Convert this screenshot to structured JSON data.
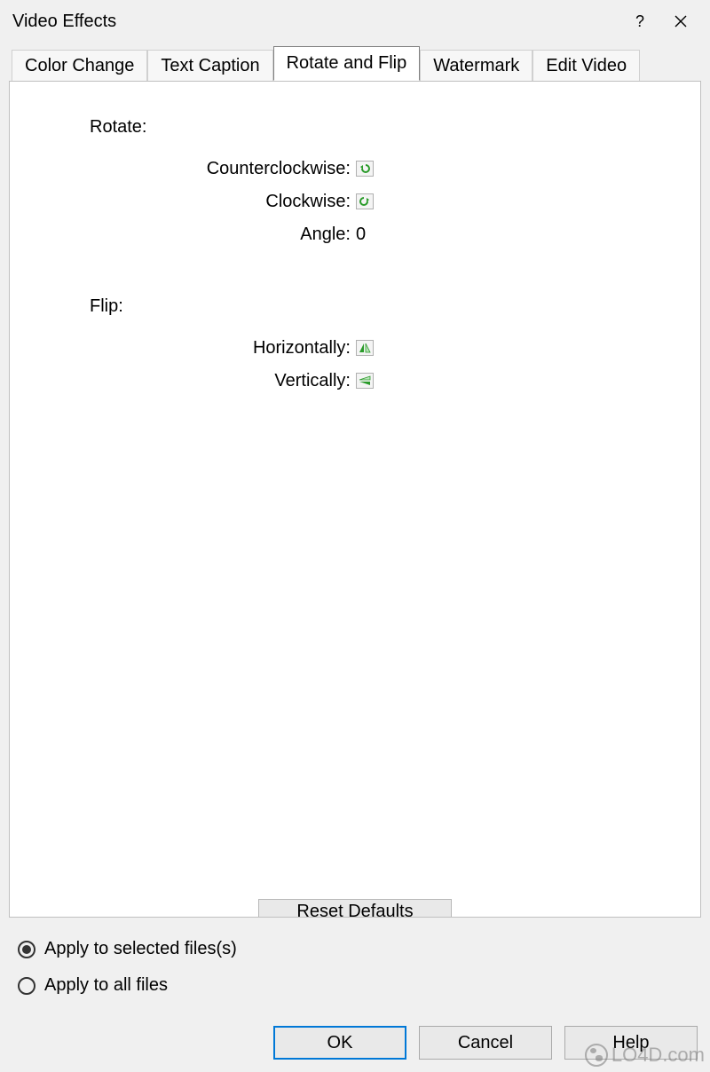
{
  "dialog": {
    "title": "Video Effects"
  },
  "tabs": [
    {
      "label": "Color Change"
    },
    {
      "label": "Text Caption"
    },
    {
      "label": "Rotate and Flip"
    },
    {
      "label": "Watermark"
    },
    {
      "label": "Edit Video"
    }
  ],
  "rotate": {
    "section_label": "Rotate:",
    "ccw_label": "Counterclockwise:",
    "cw_label": "Clockwise:",
    "angle_label": "Angle:",
    "angle_value": "0"
  },
  "flip": {
    "section_label": "Flip:",
    "horiz_label": "Horizontally:",
    "vert_label": "Vertically:"
  },
  "reset_label": "Reset Defaults",
  "apply": {
    "selected_label": "Apply to selected files(s)",
    "all_label": "Apply to all files",
    "selected_checked": true
  },
  "buttons": {
    "ok": "OK",
    "cancel": "Cancel",
    "help": "Help"
  },
  "watermark_text": "LO4D.com"
}
